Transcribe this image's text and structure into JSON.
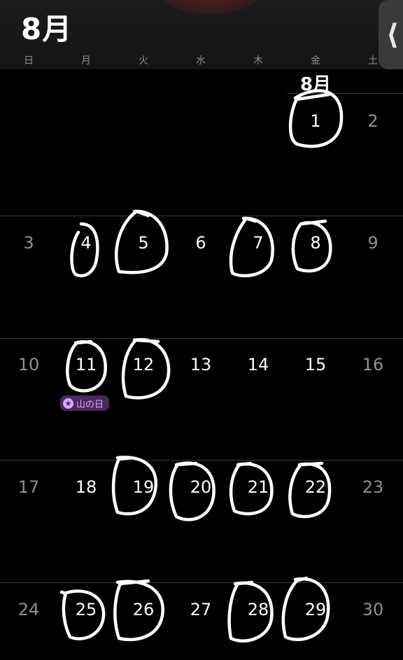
{
  "header": {
    "month_title": "8月",
    "side_tab_glyph": "⟨"
  },
  "weekdays": [
    "日",
    "月",
    "火",
    "水",
    "木",
    "金",
    "土"
  ],
  "month_inline": "8月",
  "weeks": [
    [
      "",
      "",
      "",
      "",
      "",
      "1",
      "2"
    ],
    [
      "3",
      "4",
      "5",
      "6",
      "7",
      "8",
      "9"
    ],
    [
      "10",
      "11",
      "12",
      "13",
      "14",
      "15",
      "16"
    ],
    [
      "17",
      "18",
      "19",
      "20",
      "21",
      "22",
      "23"
    ],
    [
      "24",
      "25",
      "26",
      "27",
      "28",
      "29",
      "30"
    ]
  ],
  "holiday": {
    "label": "山の日",
    "icon": "star-icon"
  },
  "circled_days": [
    "1",
    "4",
    "5",
    "7",
    "8",
    "11",
    "12",
    "19",
    "20",
    "21",
    "22",
    "25",
    "26",
    "28",
    "29"
  ],
  "colors": {
    "background": "#000000",
    "weekend_text": "#8e8e93",
    "holiday_badge": "#4a2a5e",
    "holiday_text": "#d7a9ff"
  }
}
